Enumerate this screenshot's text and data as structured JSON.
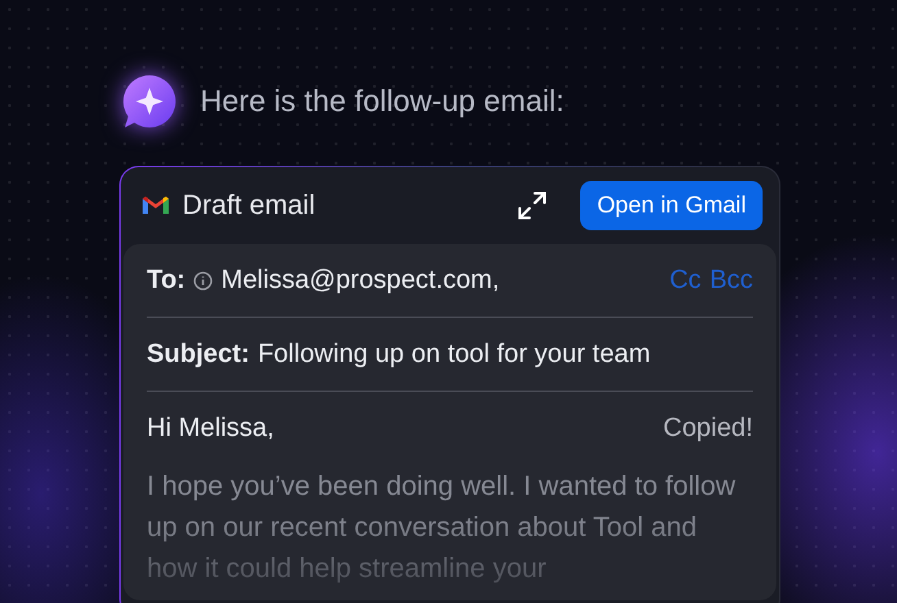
{
  "assistant": {
    "message": "Here is the follow-up email:"
  },
  "draft": {
    "title": "Draft email",
    "open_button": "Open in Gmail",
    "to": {
      "label": "To:",
      "recipient": "Melissa@prospect.com,",
      "cc": "Cc",
      "bcc": "Bcc"
    },
    "subject": {
      "label": "Subject:",
      "value": "Following up on tool for your team"
    },
    "greeting": "Hi Melissa,",
    "status": "Copied!",
    "body": "I hope you’ve been doing well. I wanted to follow up on our recent conversation about Tool and how it could help streamline your"
  }
}
